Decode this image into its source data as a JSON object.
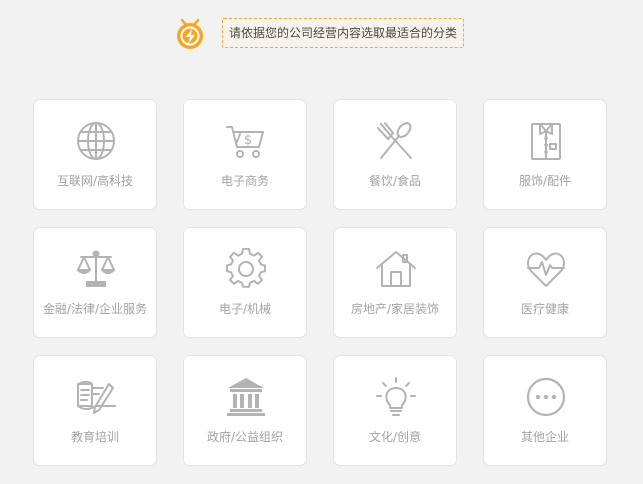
{
  "header": {
    "logo_icon": "lightning-bolt-badge-icon",
    "prompt": "请依据您的公司经营内容选取最适合的分类",
    "accent_color": "#f5a623"
  },
  "categories": [
    {
      "label": "互联网/高科技",
      "icon": "globe-icon"
    },
    {
      "label": "电子商务",
      "icon": "shopping-cart-icon"
    },
    {
      "label": "餐饮/食品",
      "icon": "fork-spoon-icon"
    },
    {
      "label": "服饰/配件",
      "icon": "shirt-icon"
    },
    {
      "label": "金融/法律/企业服务",
      "icon": "scales-icon"
    },
    {
      "label": "电子/机械",
      "icon": "gear-icon"
    },
    {
      "label": "房地产/家居装饰",
      "icon": "house-icon"
    },
    {
      "label": "医疗健康",
      "icon": "heart-pulse-icon"
    },
    {
      "label": "教育培训",
      "icon": "book-pen-icon"
    },
    {
      "label": "政府/公益组织",
      "icon": "government-building-icon"
    },
    {
      "label": "文化/创意",
      "icon": "lightbulb-icon"
    },
    {
      "label": "其他企业",
      "icon": "more-dots-icon"
    }
  ]
}
